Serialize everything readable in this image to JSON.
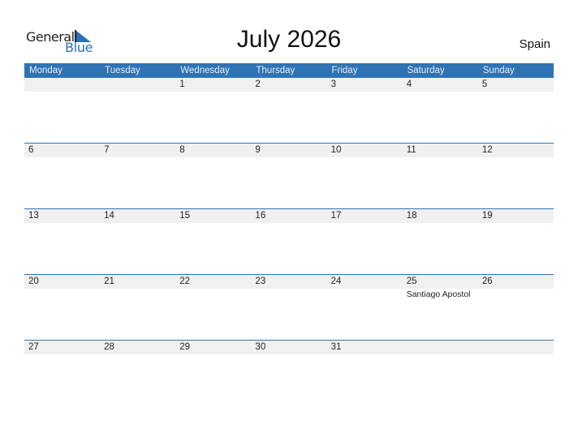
{
  "logo": {
    "word1": "General",
    "word2": "Blue"
  },
  "title": "July 2026",
  "country": "Spain",
  "colors": {
    "accent": "#2e73b4",
    "strip": "#f0f0f0"
  },
  "weekdays": [
    "Monday",
    "Tuesday",
    "Wednesday",
    "Thursday",
    "Friday",
    "Saturday",
    "Sunday"
  ],
  "weeks": [
    {
      "days": [
        {
          "num": ""
        },
        {
          "num": ""
        },
        {
          "num": "1"
        },
        {
          "num": "2"
        },
        {
          "num": "3"
        },
        {
          "num": "4"
        },
        {
          "num": "5"
        }
      ]
    },
    {
      "days": [
        {
          "num": "6"
        },
        {
          "num": "7"
        },
        {
          "num": "8"
        },
        {
          "num": "9"
        },
        {
          "num": "10"
        },
        {
          "num": "11"
        },
        {
          "num": "12"
        }
      ]
    },
    {
      "days": [
        {
          "num": "13"
        },
        {
          "num": "14"
        },
        {
          "num": "15"
        },
        {
          "num": "16"
        },
        {
          "num": "17"
        },
        {
          "num": "18"
        },
        {
          "num": "19"
        }
      ]
    },
    {
      "days": [
        {
          "num": "20"
        },
        {
          "num": "21"
        },
        {
          "num": "22"
        },
        {
          "num": "23"
        },
        {
          "num": "24"
        },
        {
          "num": "25",
          "event": "Santiago Apostol"
        },
        {
          "num": "26"
        }
      ]
    },
    {
      "days": [
        {
          "num": "27"
        },
        {
          "num": "28"
        },
        {
          "num": "29"
        },
        {
          "num": "30"
        },
        {
          "num": "31"
        },
        {
          "num": ""
        },
        {
          "num": ""
        }
      ]
    }
  ]
}
